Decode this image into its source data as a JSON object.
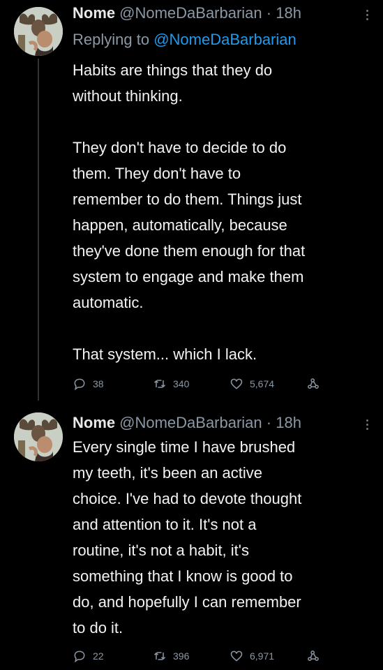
{
  "tweets": [
    {
      "author_name": "Nome",
      "author_handle": "@NomeDaBarbarian",
      "time": "· 18h",
      "replying_label": "Replying to",
      "replying_handle": "@NomeDaBarbarian",
      "text": "Habits are things that they do\nwithout thinking.\n\nThey don't have to decide to do\nthem. They don't have to\nremember to do them. Things just\nhappen, automatically, because\nthey've done them enough for that\nsystem to engage and make them\nautomatic.\n\nThat system... which I lack.",
      "replies": "38",
      "retweets": "340",
      "likes": "5,674"
    },
    {
      "author_name": "Nome",
      "author_handle": "@NomeDaBarbarian",
      "time": "· 18h",
      "text": "Every single time I have brushed\nmy teeth, it's been an active\nchoice. I've had to devote thought\nand attention to it. It's not a\nroutine, it's not a habit, it's\nsomething that I know is good to\ndo, and hopefully I can remember\nto do it.",
      "replies": "22",
      "retweets": "396",
      "likes": "6,971"
    }
  ],
  "icons": {
    "reply": "reply-icon",
    "retweet": "retweet-icon",
    "like": "heart-icon",
    "share": "share-icon",
    "more": "more-icon"
  },
  "colors": {
    "background": "#000000",
    "link": "#1d9bf0",
    "muted": "#8b98a5",
    "text": "#e7e9ea"
  }
}
